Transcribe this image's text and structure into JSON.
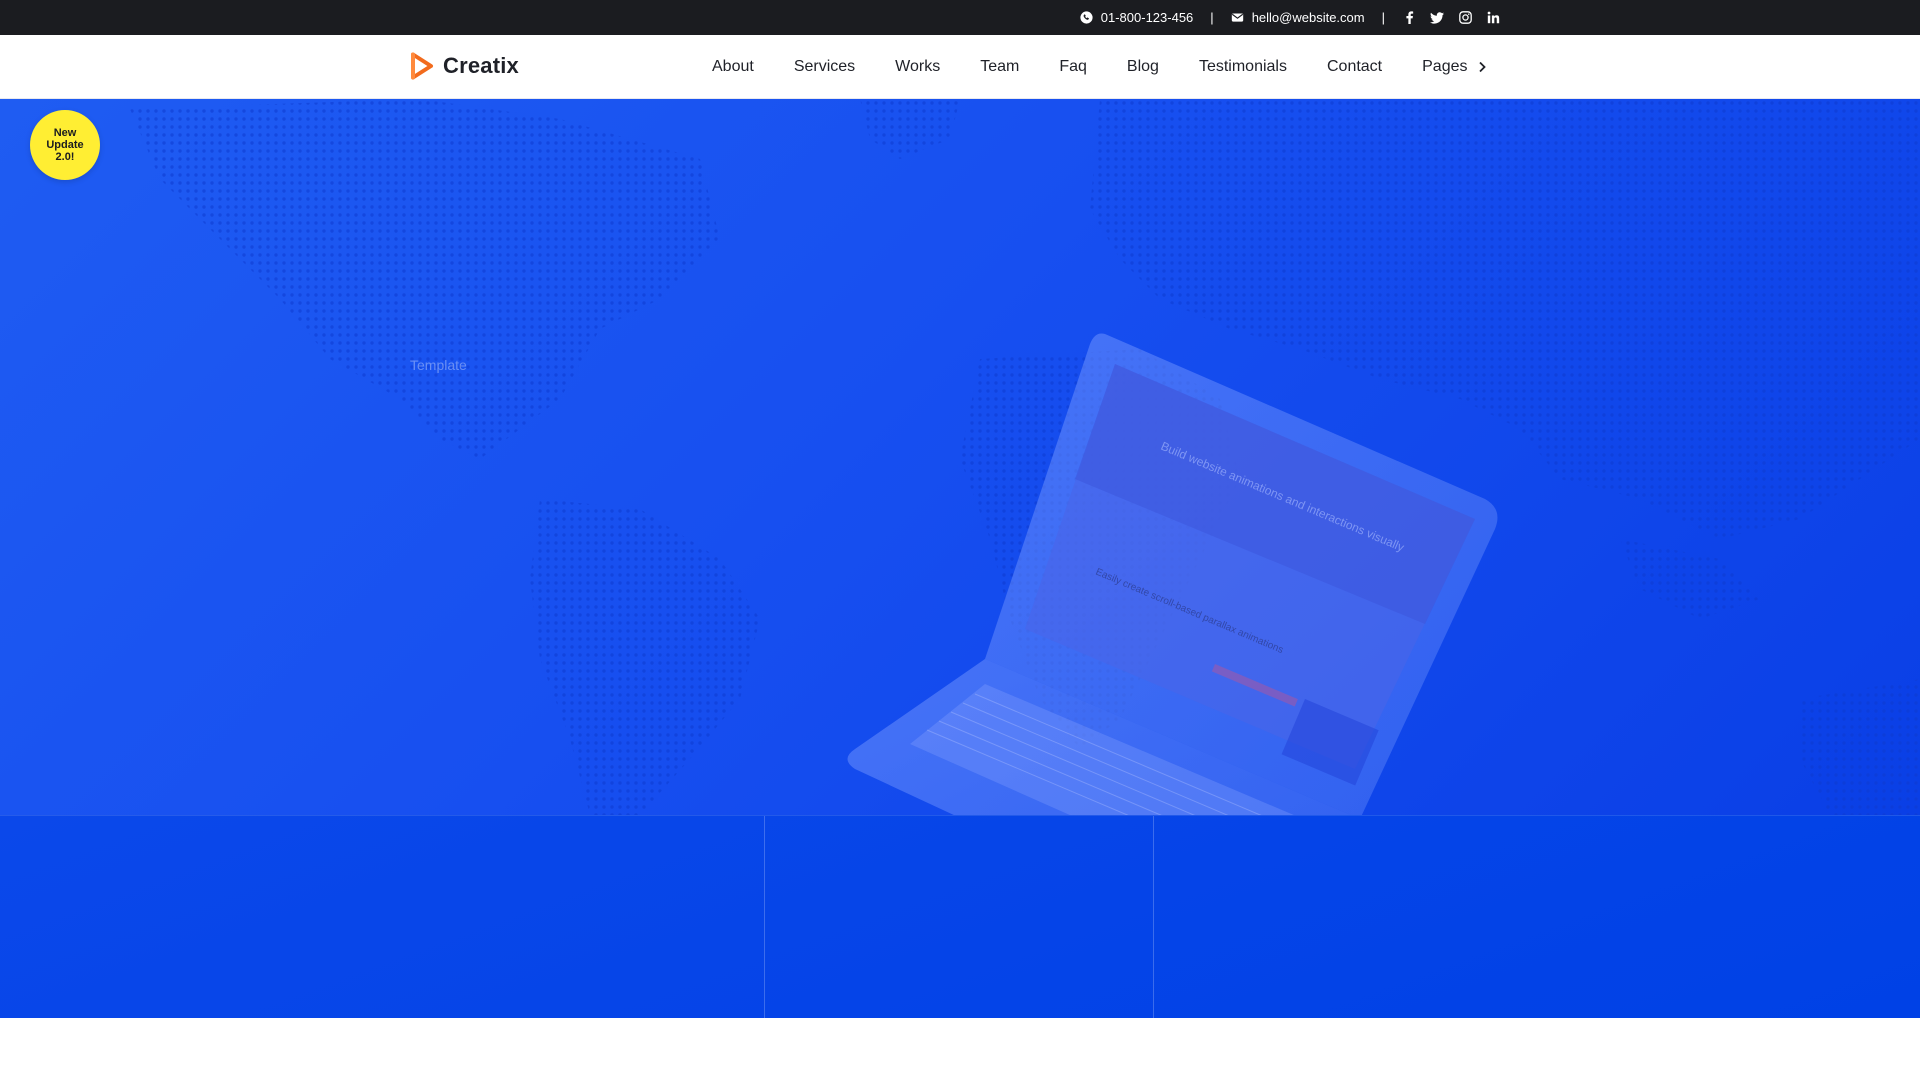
{
  "topbar": {
    "phone": "01-800-123-456",
    "email": "hello@website.com",
    "separator": "|",
    "social": [
      "facebook-icon",
      "twitter-icon",
      "instagram-icon",
      "linkedin-icon"
    ]
  },
  "logo": {
    "text": "Creatix",
    "color": "#f26b1d"
  },
  "nav": {
    "items": [
      "About",
      "Services",
      "Works",
      "Team",
      "Faq",
      "Blog",
      "Testimonials",
      "Contact"
    ],
    "pages_label": "Pages"
  },
  "badge": {
    "line1": "New",
    "line2": "Update",
    "line3": "2.0!"
  },
  "hero": {
    "faint_text": "Template",
    "laptop_heading": "Build website animations and interactions visually",
    "laptop_subheading": "Easily create scroll-based parallax animations"
  },
  "colors": {
    "topbar_bg": "#1b1c20",
    "hero_blue": "#174ff0",
    "badge_yellow": "#ffee33",
    "accent_orange": "#f26b1d"
  }
}
